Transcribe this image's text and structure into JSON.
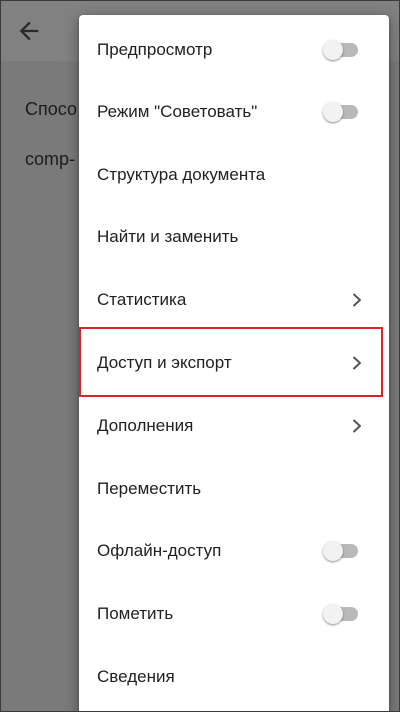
{
  "app": {
    "doc_lines": [
      "Спосо",
      "comp-"
    ]
  },
  "icons": {
    "back": "arrow-left-icon",
    "chevron": "chevron-right-icon",
    "toggle": "toggle-switch-off-icon"
  },
  "colors": {
    "highlight_border": "#e0202a",
    "toggle_track": "#b9b9b9",
    "toggle_thumb": "#f2f2f2",
    "menu_background": "#ffffff",
    "scrim": "#777777"
  },
  "menu": {
    "items": [
      {
        "label": "Предпросмотр",
        "control": "toggle",
        "on": false
      },
      {
        "label": "Режим \"Советовать\"",
        "control": "toggle",
        "on": false
      },
      {
        "label": "Структура документа",
        "control": "none"
      },
      {
        "label": "Найти и заменить",
        "control": "none"
      },
      {
        "label": "Статистика",
        "control": "submenu"
      },
      {
        "label": "Доступ и экспорт",
        "control": "submenu",
        "highlighted": true
      },
      {
        "label": "Дополнения",
        "control": "submenu"
      },
      {
        "label": "Переместить",
        "control": "none"
      },
      {
        "label": "Офлайн-доступ",
        "control": "toggle",
        "on": false
      },
      {
        "label": "Пометить",
        "control": "toggle",
        "on": false
      },
      {
        "label": "Сведения",
        "control": "none"
      }
    ]
  }
}
